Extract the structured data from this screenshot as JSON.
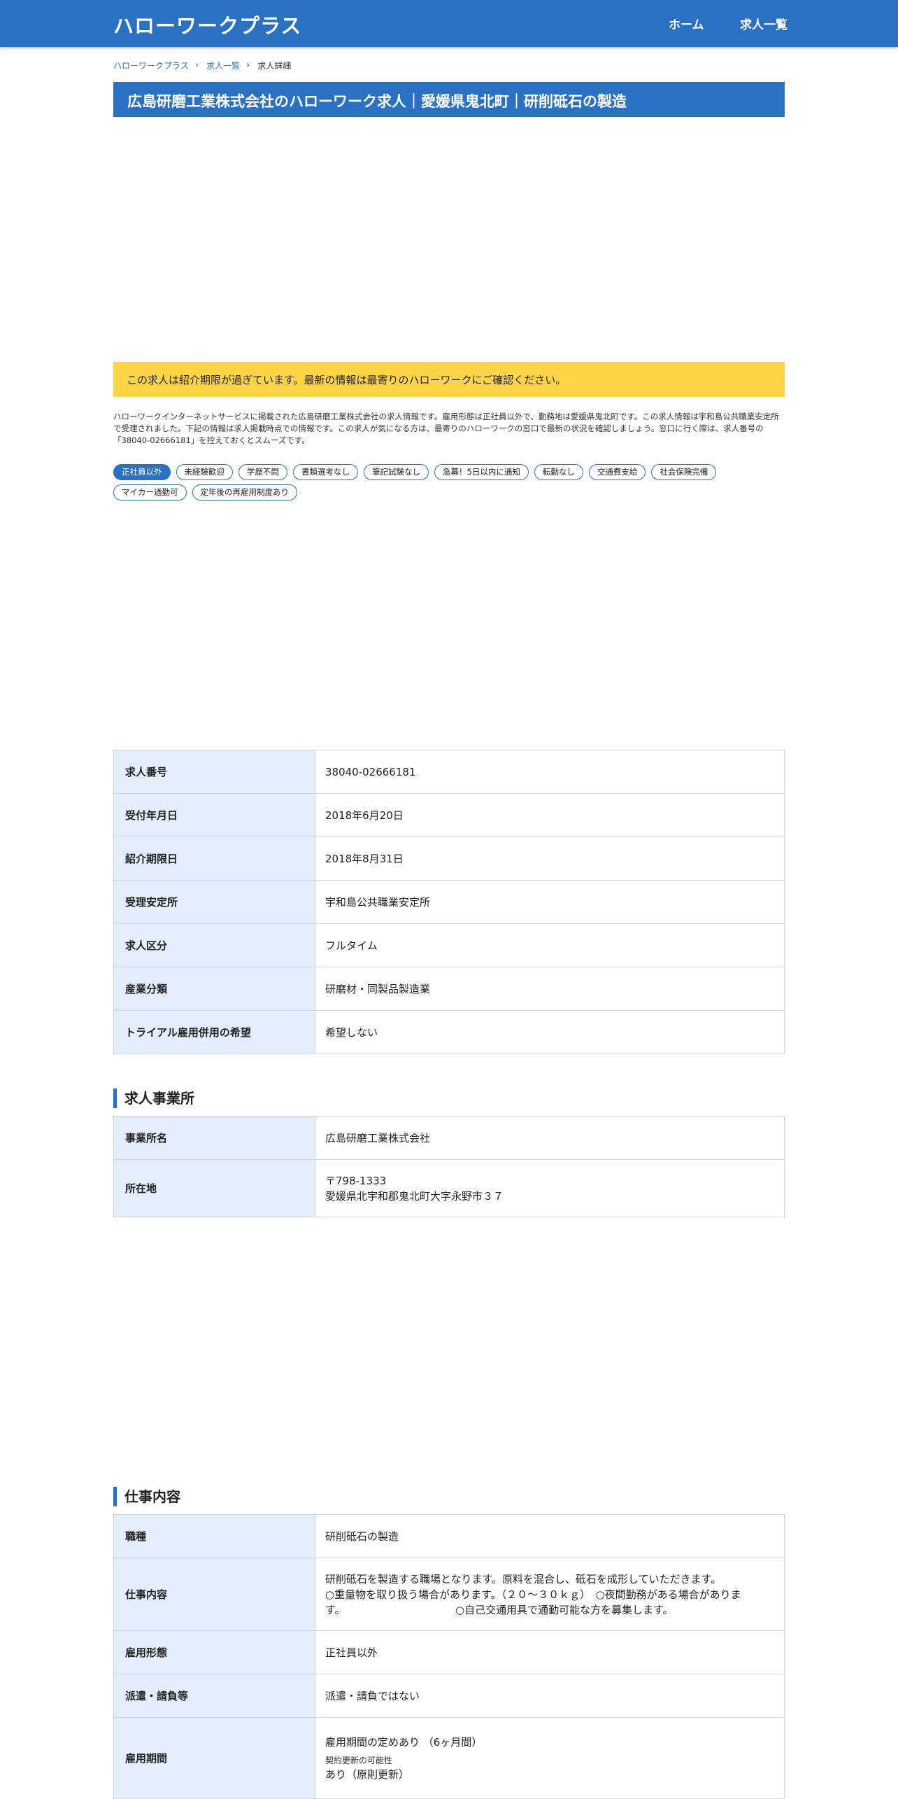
{
  "header": {
    "logo": "ハローワークプラス",
    "nav": {
      "home": "ホーム",
      "jobs": "求人一覧"
    }
  },
  "breadcrumb": {
    "home": "ハローワークプラス",
    "list": "求人一覧",
    "current": "求人詳細",
    "separator": "›"
  },
  "page_title": "広島研磨工業株式会社のハローワーク求人｜愛媛県鬼北町｜研削砥石の製造",
  "alert": "この求人は紹介期限が過ぎています。最新の情報は最寄りのハローワークにご確認ください。",
  "description": "ハローワークインターネットサービスに掲載された広島研磨工業株式会社の求人情報です。雇用形態は正社員以外で、勤務地は愛媛県鬼北町です。この求人情報は宇和島公共職業安定所で受理されました。下記の情報は求人掲載時点での情報です。この求人が気になる方は、最寄りのハローワークの窓口で最新の状況を確認しましょう。窓口に行く際は、求人番号の「38040-02666181」を控えておくとスムーズです。",
  "tags": [
    "正社員以外",
    "未経験歓迎",
    "学歴不問",
    "書類選考なし",
    "筆記試験なし",
    "急募！5日以内に通知",
    "転勤なし",
    "交通費支給",
    "社会保険完備",
    "マイカー通勤可",
    "定年後の再雇用制度あり"
  ],
  "basic_info": [
    {
      "label": "求人番号",
      "value": "38040-02666181"
    },
    {
      "label": "受付年月日",
      "value": "2018年6月20日"
    },
    {
      "label": "紹介期限日",
      "value": "2018年8月31日"
    },
    {
      "label": "受理安定所",
      "value": "宇和島公共職業安定所"
    },
    {
      "label": "求人区分",
      "value": "フルタイム"
    },
    {
      "label": "産業分類",
      "value": "研磨材・同製品製造業"
    },
    {
      "label": "トライアル雇用併用の希望",
      "value": "希望しない"
    }
  ],
  "office_section": {
    "heading": "求人事業所",
    "name_label": "事業所名",
    "name_value": "広島研磨工業株式会社",
    "address_label": "所在地",
    "postal": "〒798-1333",
    "address": "愛媛県北宇和郡鬼北町大字永野市３７"
  },
  "job_section": {
    "heading": "仕事内容",
    "occupation_label": "職種",
    "occupation_value": "研削砥石の製造",
    "content_label": "仕事内容",
    "content_line1": "研削砥石を製造する職場となります。原料を混合し、砥石を成形していただきます。",
    "content_line2": "○重量物を取り扱う場合があります。（２０～３０ｋｇ）　○夜間勤務がある場合がありま",
    "content_line3": "す。　　　　　　　　　　　○自己交通用具で通勤可能な方を募集します。",
    "employment_label": "雇用形態",
    "employment_value": "正社員以外",
    "dispatch_label": "派遣・請負等",
    "dispatch_value": "派遣・請負ではない",
    "period_label": "雇用期間",
    "period_value": "雇用期間の定めあり （6ヶ月間）",
    "renewal_label": "契約更新の可能性",
    "renewal_value": "あり（原則更新）"
  }
}
